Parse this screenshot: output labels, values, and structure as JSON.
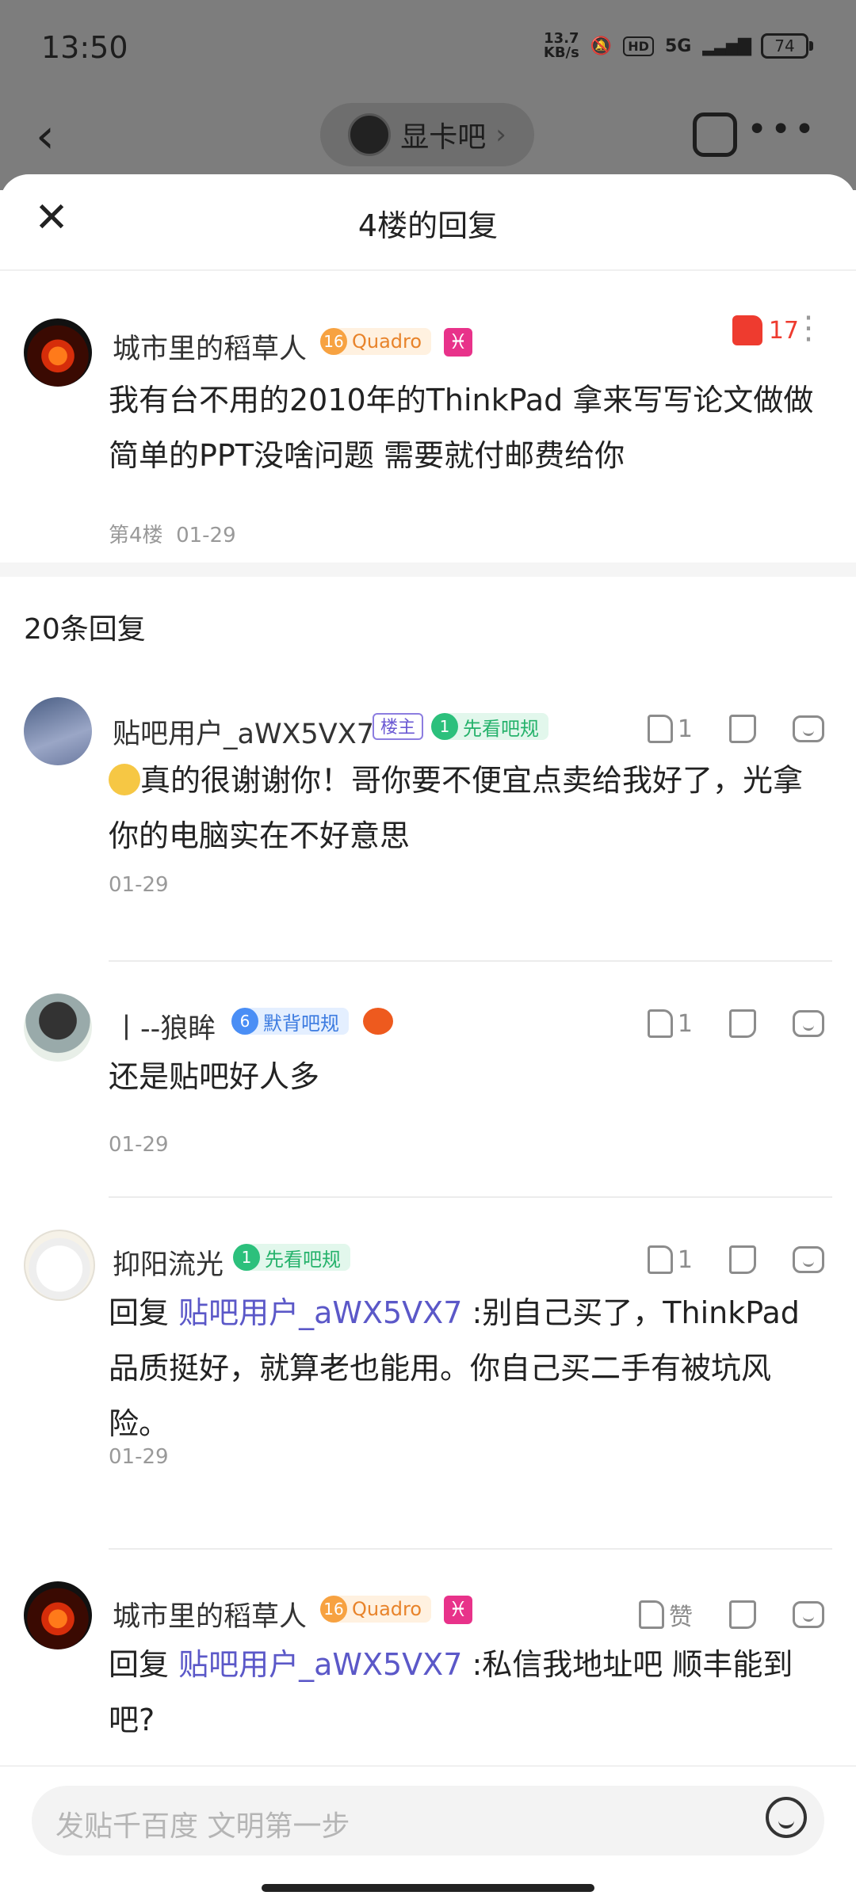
{
  "status": {
    "time": "13:50",
    "net_speed_top": "13.7",
    "net_speed_bottom": "KB/s",
    "hd": "HD",
    "network": "5G",
    "battery": "74"
  },
  "nav": {
    "forum_name": "显卡吧"
  },
  "sheet": {
    "title": "4楼的回复",
    "main_post": {
      "username": "城市里的稻草人",
      "level": "16",
      "level_name": "Quadro",
      "zodiac": "♓",
      "likes": "17",
      "content": "我有台不用的2010年的ThinkPad 拿来写写论文做做简单的PPT没啥问题 需要就付邮费给你",
      "floor": "第4楼",
      "date": "01-29"
    },
    "reply_count": "20条回复",
    "replies": [
      {
        "username": "贴吧用户_aWX5VX7",
        "host_tag": "楼主",
        "level": "1",
        "level_name": "先看吧规",
        "likes": "1",
        "content": "真的很谢谢你！哥你要不便宜点卖给我好了，光拿你的电脑实在不好意思",
        "date": "01-29"
      },
      {
        "username": "丨--狼眸",
        "level": "6",
        "level_name": "默背吧规",
        "likes": "1",
        "content": "还是贴吧好人多",
        "date": "01-29"
      },
      {
        "username": "抑阳流光",
        "level": "1",
        "level_name": "先看吧规",
        "likes": "1",
        "reply_prefix": "回复",
        "mention": "贴吧用户_aWX5VX7",
        "content": ":别自己买了，ThinkPad品质挺好，就算老也能用。你自己买二手有被坑风险。",
        "date": "01-29"
      },
      {
        "username": "城市里的稻草人",
        "level": "16",
        "level_name": "Quadro",
        "zodiac": "♓",
        "like_label": "赞",
        "reply_prefix": "回复",
        "mention": "贴吧用户_aWX5VX7",
        "content": ":私信我地址吧 顺丰能到吧?"
      }
    ]
  },
  "composer": {
    "placeholder": "发贴千百度 文明第一步"
  }
}
